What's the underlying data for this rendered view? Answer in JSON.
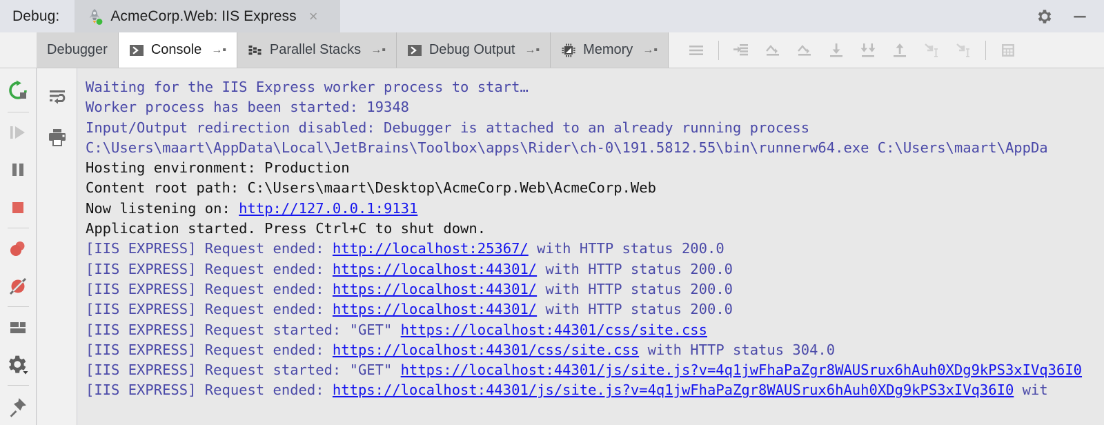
{
  "titlebar": {
    "label": "Debug:",
    "tab": {
      "icon": "rocket-icon",
      "title": "AcmeCorp.Web: IIS Express",
      "close": "×"
    },
    "actions": [
      {
        "name": "settings-gear-icon",
        "label": "gear-icon"
      },
      {
        "name": "minimize-icon",
        "label": "minimize-icon"
      }
    ]
  },
  "toolbar": {
    "tabs": [
      {
        "label": "Debugger",
        "icon": null,
        "pin": null,
        "active": false
      },
      {
        "label": "Console",
        "icon": "console-icon",
        "pin": "→▪",
        "active": true
      },
      {
        "label": "Parallel Stacks",
        "icon": "stacks-icon",
        "pin": "→▪",
        "active": false
      },
      {
        "label": "Debug Output",
        "icon": "console-icon",
        "pin": "→▪",
        "active": false
      },
      {
        "label": "Memory",
        "icon": "memory-chip-icon",
        "pin": "→▪",
        "active": false
      }
    ],
    "buttons": [
      "menu-lines-icon",
      "separator",
      "run-to-cursor-icon",
      "step-over-icon",
      "step-over-2-icon",
      "step-into-icon",
      "force-step-into-icon",
      "step-out-icon",
      "smart-step-into-icon",
      "smart-step-into-2-icon",
      "separator",
      "evaluate-expression-icon"
    ]
  },
  "rail": {
    "buttons": [
      "rerun-icon",
      "separator",
      "resume-program-icon",
      "pause-program-icon",
      "stop-icon",
      "separator",
      "view-breakpoints-icon",
      "mute-breakpoints-icon",
      "separator",
      "layout-settings-icon",
      "settings-gear-dropdown-icon",
      "separator",
      "pin-tab-icon"
    ]
  },
  "gutter": {
    "buttons": [
      "soft-wrap-icon",
      "print-icon"
    ]
  },
  "console": {
    "colors": {
      "system_text": "#4a49a8",
      "plain_text": "#141414",
      "link": "#1414ee",
      "background": "#e8e8e8"
    },
    "lines": [
      {
        "type": "sys",
        "parts": [
          {
            "t": "Waiting for the IIS Express worker process to start…"
          }
        ]
      },
      {
        "type": "sys",
        "parts": [
          {
            "t": "Worker process has been started: 19348"
          }
        ]
      },
      {
        "type": "sys",
        "parts": [
          {
            "t": "Input/Output redirection disabled: Debugger is attached to an already running process"
          }
        ]
      },
      {
        "type": "sys",
        "parts": [
          {
            "t": "C:\\Users\\maart\\AppData\\Local\\JetBrains\\Toolbox\\apps\\Rider\\ch-0\\191.5812.55\\bin\\runnerw64.exe C:\\Users\\maart\\AppDa"
          }
        ]
      },
      {
        "type": "plain",
        "parts": [
          {
            "t": "Hosting environment: Production"
          }
        ]
      },
      {
        "type": "plain",
        "parts": [
          {
            "t": "Content root path: C:\\Users\\maart\\Desktop\\AcmeCorp.Web\\AcmeCorp.Web"
          }
        ]
      },
      {
        "type": "plain",
        "parts": [
          {
            "t": "Now listening on: "
          },
          {
            "t": "http://127.0.0.1:9131",
            "link": true
          }
        ]
      },
      {
        "type": "plain",
        "parts": [
          {
            "t": "Application started. Press Ctrl+C to shut down."
          }
        ]
      },
      {
        "type": "sys",
        "parts": [
          {
            "t": "[IIS EXPRESS] Request ended: "
          },
          {
            "t": "http://localhost:25367/",
            "link": true
          },
          {
            "t": " with HTTP status 200.0"
          }
        ]
      },
      {
        "type": "sys",
        "parts": [
          {
            "t": "[IIS EXPRESS] Request ended: "
          },
          {
            "t": "https://localhost:44301/",
            "link": true
          },
          {
            "t": " with HTTP status 200.0"
          }
        ]
      },
      {
        "type": "sys",
        "parts": [
          {
            "t": "[IIS EXPRESS] Request ended: "
          },
          {
            "t": "https://localhost:44301/",
            "link": true
          },
          {
            "t": " with HTTP status 200.0"
          }
        ]
      },
      {
        "type": "sys",
        "parts": [
          {
            "t": "[IIS EXPRESS] Request ended: "
          },
          {
            "t": "https://localhost:44301/",
            "link": true
          },
          {
            "t": " with HTTP status 200.0"
          }
        ]
      },
      {
        "type": "sys",
        "parts": [
          {
            "t": "[IIS EXPRESS] Request started: \"GET\" "
          },
          {
            "t": "https://localhost:44301/css/site.css",
            "link": true
          }
        ]
      },
      {
        "type": "sys",
        "parts": [
          {
            "t": "[IIS EXPRESS] Request ended: "
          },
          {
            "t": "https://localhost:44301/css/site.css",
            "link": true
          },
          {
            "t": " with HTTP status 304.0"
          }
        ]
      },
      {
        "type": "sys",
        "parts": [
          {
            "t": "[IIS EXPRESS] Request started: \"GET\" "
          },
          {
            "t": "https://localhost:44301/js/site.js?v=4q1jwFhaPaZgr8WAUSrux6hAuh0XDg9kPS3xIVq36I0",
            "link": true
          }
        ]
      },
      {
        "type": "sys",
        "parts": [
          {
            "t": "[IIS EXPRESS] Request ended: "
          },
          {
            "t": "https://localhost:44301/js/site.js?v=4q1jwFhaPaZgr8WAUSrux6hAuh0XDg9kPS3xIVq36I0",
            "link": true
          },
          {
            "t": " wit"
          }
        ]
      }
    ]
  }
}
